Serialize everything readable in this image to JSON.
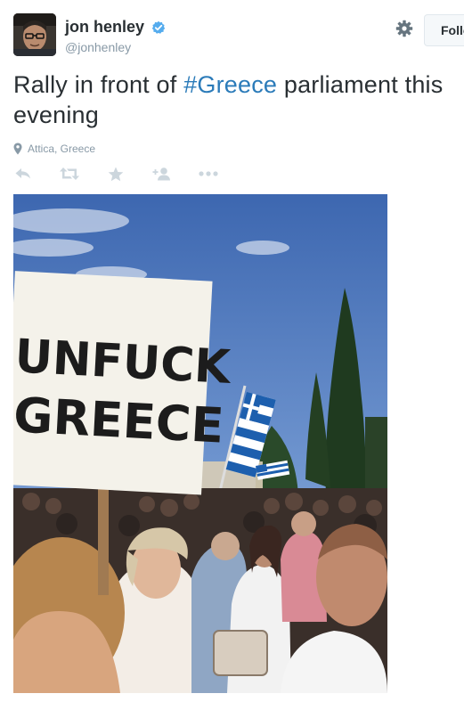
{
  "user": {
    "display_name": "jon henley",
    "handle": "@jonhenley",
    "verified": true
  },
  "follow_button": {
    "label": "Follow"
  },
  "tweet": {
    "text_before": "Rally in front of ",
    "hashtag": "#Greece",
    "text_after": " parliament this evening",
    "location": "Attica, Greece"
  },
  "actions": [
    "reply-icon",
    "retweet-icon",
    "favorite-icon",
    "follow-icon",
    "more-icon"
  ],
  "photo": {
    "sign_line1": "UNFUCK",
    "sign_line2": "GREECE"
  },
  "colors": {
    "hashtag": "#2b7bb9",
    "verified": "#55acee",
    "muted": "#8899a6",
    "icon": "#ccd6dd"
  }
}
